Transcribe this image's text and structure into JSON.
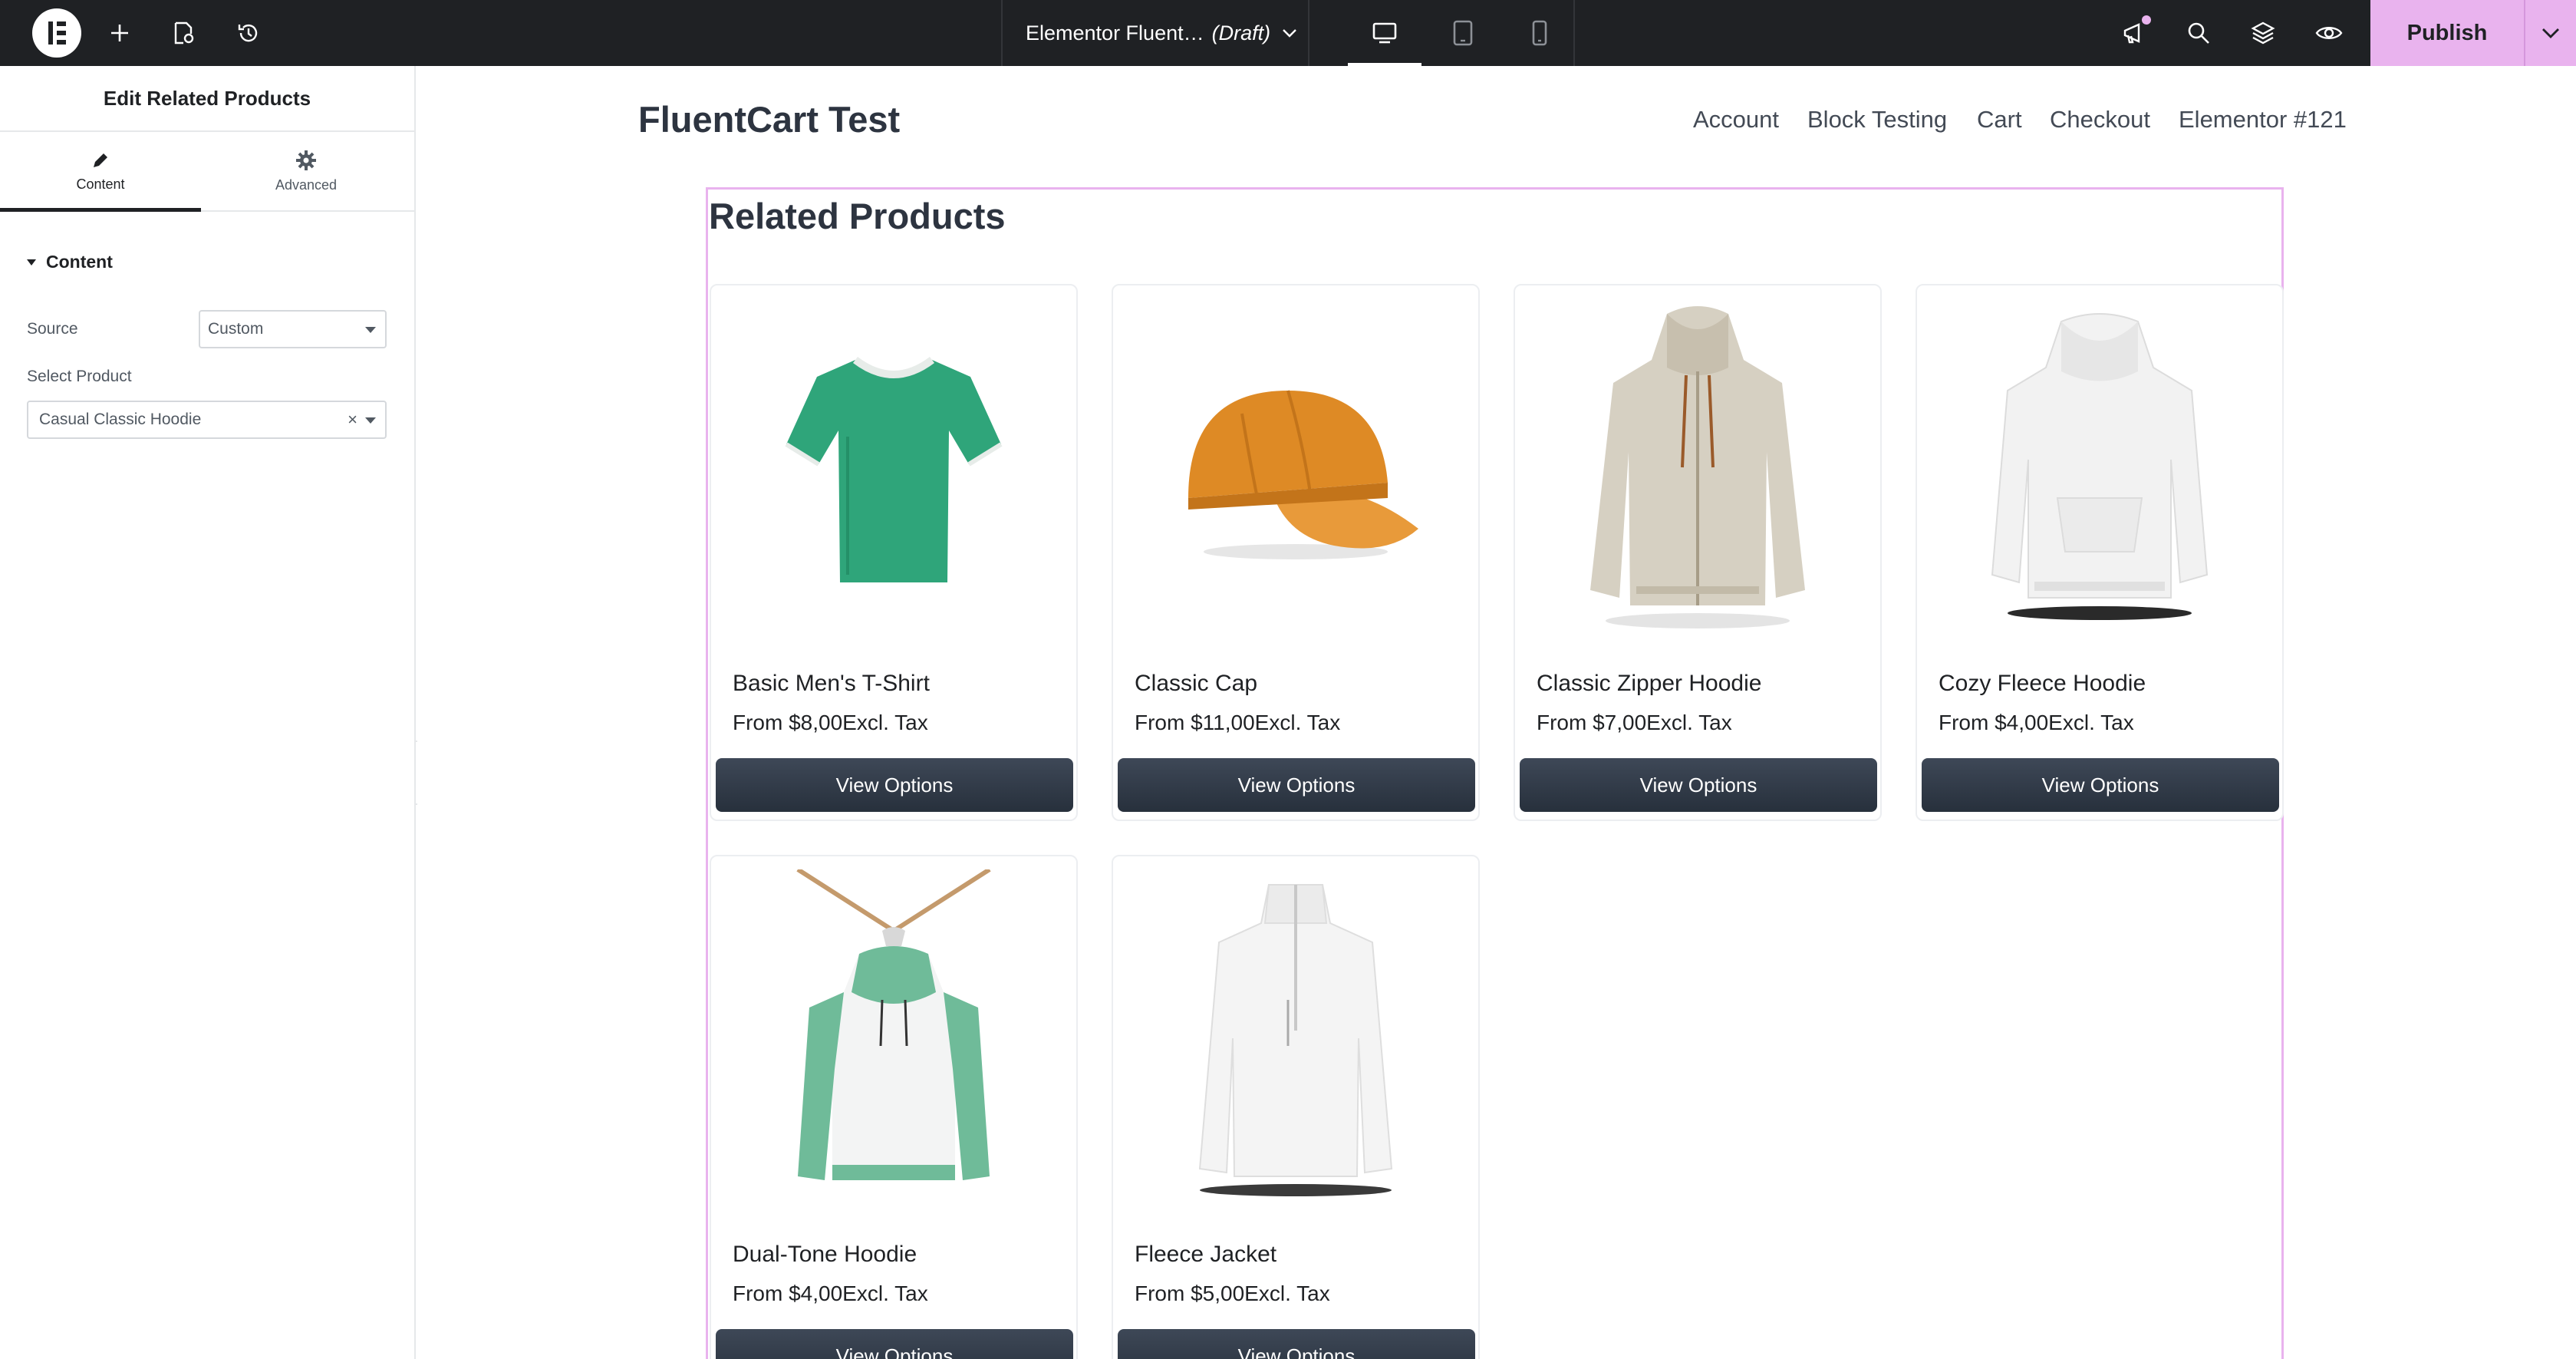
{
  "topbar": {
    "document_title": "Elementor Fluent…",
    "document_status": "(Draft)",
    "publish_label": "Publish"
  },
  "panel": {
    "title": "Edit Related Products",
    "tabs": [
      {
        "label": "Content",
        "active": true
      },
      {
        "label": "Advanced",
        "active": false
      }
    ],
    "section_title": "Content",
    "controls": {
      "source_label": "Source",
      "source_value": "Custom",
      "product_label": "Select Product",
      "product_value": "Casual Classic Hoodie"
    }
  },
  "site": {
    "title": "FluentCart Test",
    "nav": [
      "Account",
      "Block Testing",
      "Cart",
      "Checkout",
      "Elementor #121"
    ]
  },
  "related": {
    "heading": "Related Products",
    "products": [
      {
        "name": "Basic Men's T-Shirt",
        "price": "From $8,00Excl. Tax",
        "button": "View Options",
        "image": "green-tshirt"
      },
      {
        "name": "Classic Cap",
        "price": "From $11,00Excl. Tax",
        "button": "View Options",
        "image": "orange-cap"
      },
      {
        "name": "Classic Zipper Hoodie",
        "price": "From $7,00Excl. Tax",
        "button": "View Options",
        "image": "beige-zip-hoodie"
      },
      {
        "name": "Cozy Fleece Hoodie",
        "price": "From $4,00Excl. Tax",
        "button": "View Options",
        "image": "white-hoodie"
      },
      {
        "name": "Dual-Tone Hoodie",
        "price": "From $4,00Excl. Tax",
        "button": "View Options",
        "image": "green-white-hoodie"
      },
      {
        "name": "Fleece Jacket",
        "price": "From $5,00Excl. Tax",
        "button": "View Options",
        "image": "white-fleece-jacket"
      }
    ]
  },
  "colors": {
    "topbar_bg": "#1f2124",
    "accent_pink": "#e9b3ee",
    "button_dark": "#2f3845"
  }
}
